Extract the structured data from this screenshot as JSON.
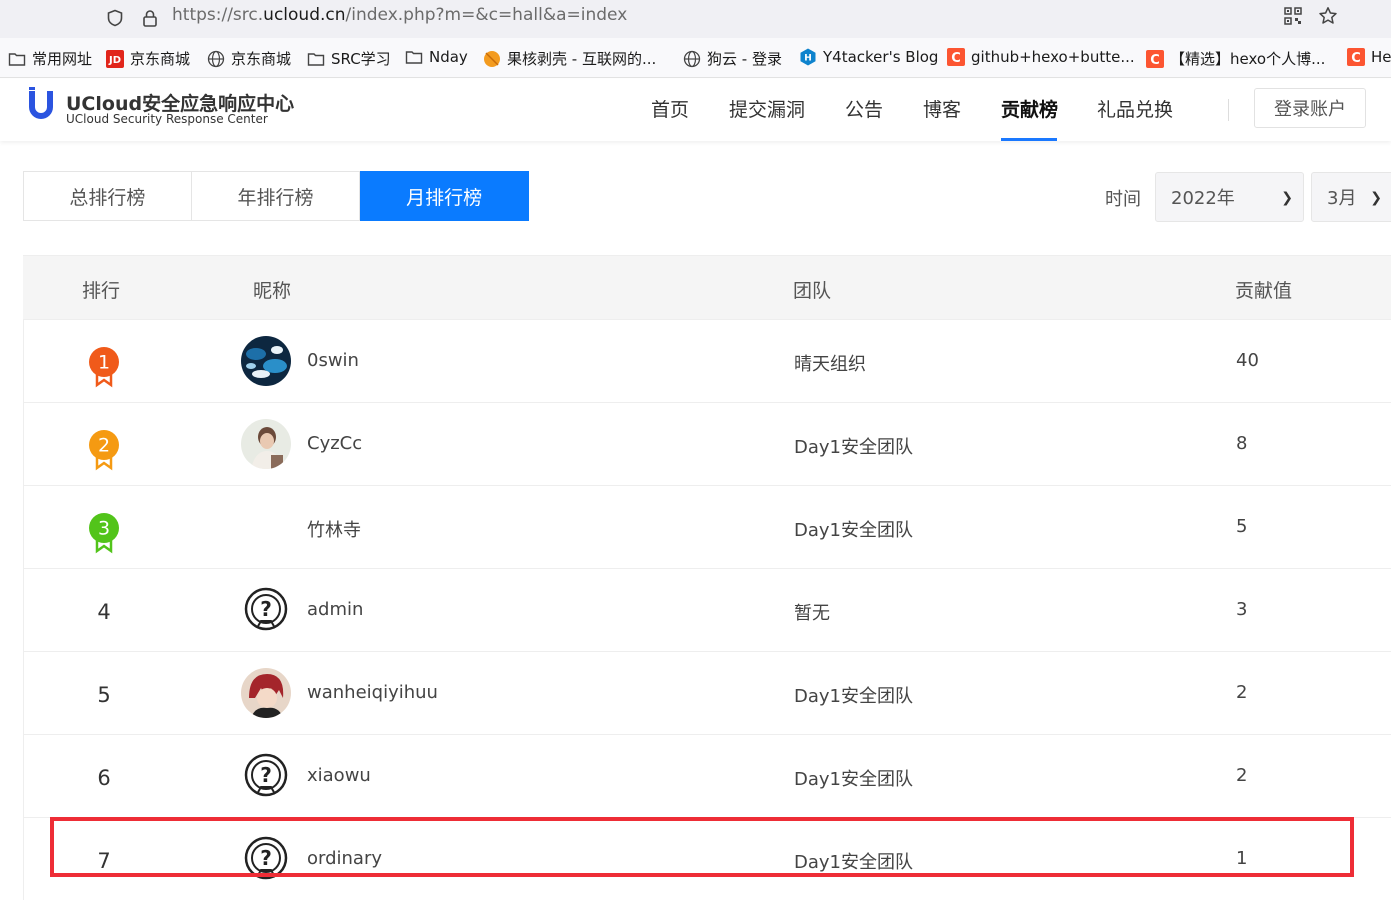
{
  "browser": {
    "url_prefix": "https://src.",
    "url_domain": "ucloud.cn",
    "url_suffix": "/index.php?m=&c=hall&a=index",
    "bookmarks": [
      {
        "label": "常用网址",
        "icon": "folder-icon"
      },
      {
        "label": "京东商城",
        "icon": "jd-icon"
      },
      {
        "label": "京东商城",
        "icon": "globe-icon"
      },
      {
        "label": "SRC学习",
        "icon": "folder-icon"
      },
      {
        "label": "Nday",
        "icon": "folder-icon"
      },
      {
        "label": "果核剥壳 - 互联网的...",
        "icon": "orange-icon"
      },
      {
        "label": "狗云 - 登录",
        "icon": "globe-icon"
      },
      {
        "label": "Y4tacker's Blog",
        "icon": "hexo-icon"
      },
      {
        "label": "github+hexo+butte...",
        "icon": "csdn-icon"
      },
      {
        "label": "【精选】hexo个人博...",
        "icon": "csdn-icon"
      },
      {
        "label": "He",
        "icon": "csdn-icon"
      }
    ]
  },
  "header": {
    "logo_title": "UCloud安全应急响应中心",
    "logo_subtitle": "UCloud Security Response Center",
    "nav": [
      "首页",
      "提交漏洞",
      "公告",
      "博客",
      "贡献榜",
      "礼品兑换"
    ],
    "active_nav": "贡献榜",
    "login": "登录账户"
  },
  "tabs": {
    "items": [
      "总排行榜",
      "年排行榜",
      "月排行榜"
    ],
    "active": "月排行榜"
  },
  "filter": {
    "time_label": "时间",
    "year": "2022年",
    "month": "3月"
  },
  "table": {
    "headers": {
      "rank": "排行",
      "nickname": "昵称",
      "team": "团队",
      "score": "贡献值"
    },
    "rows": [
      {
        "rank": "1",
        "nickname": "0swin",
        "team": "晴天组织",
        "score": "40",
        "medal_color": "#f05a1a",
        "avatar": "dark-avatar"
      },
      {
        "rank": "2",
        "nickname": "CyzCc",
        "team": "Day1安全团队",
        "score": "8",
        "medal_color": "#f59a12",
        "avatar": "photo-avatar"
      },
      {
        "rank": "3",
        "nickname": "竹林寺",
        "team": "Day1安全团队",
        "score": "5",
        "medal_color": "#52c41a",
        "avatar": "none"
      },
      {
        "rank": "4",
        "nickname": "admin",
        "team": "暂无",
        "score": "3",
        "avatar": "default-avatar"
      },
      {
        "rank": "5",
        "nickname": "wanheiqiyihuu",
        "team": "Day1安全团队",
        "score": "2",
        "avatar": "anime-avatar"
      },
      {
        "rank": "6",
        "nickname": "xiaowu",
        "team": "Day1安全团队",
        "score": "2",
        "avatar": "default-avatar"
      },
      {
        "rank": "7",
        "nickname": "ordinary",
        "team": "Day1安全团队",
        "score": "1",
        "avatar": "default-avatar"
      }
    ]
  },
  "colors": {
    "accent": "#0a7bff",
    "highlight_box": "#ee2d36"
  }
}
